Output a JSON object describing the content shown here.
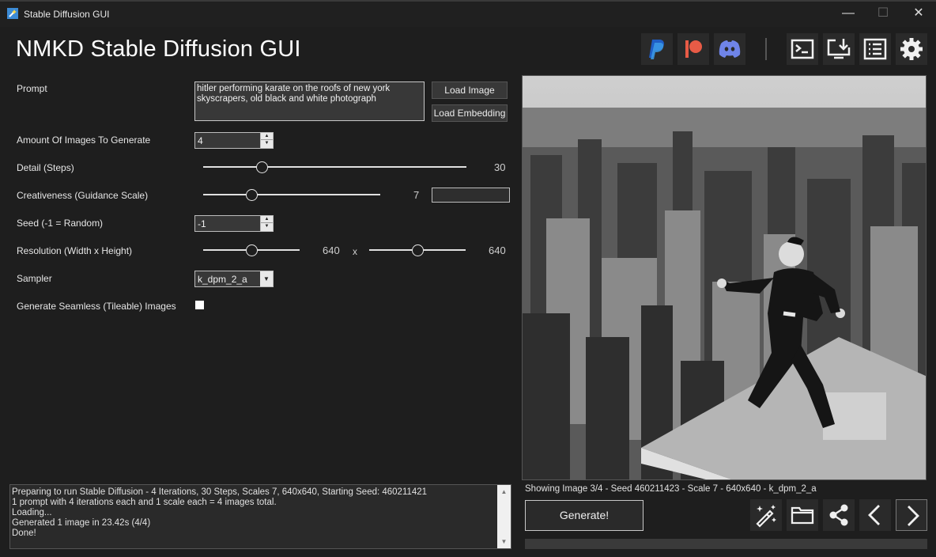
{
  "window": {
    "title": "Stable Diffusion GUI"
  },
  "header": {
    "app_title": "NMKD Stable Diffusion GUI"
  },
  "top_icons": [
    "paypal-icon",
    "patreon-icon",
    "discord-icon",
    "terminal-icon",
    "install-icon",
    "logs-icon",
    "settings-icon"
  ],
  "form": {
    "prompt_label": "Prompt",
    "prompt_value": "hitler performing karate on the roofs of new york skyscrapers, old black and white photograph",
    "load_image_label": "Load Image",
    "load_embedding_label": "Load Embedding",
    "amount_label": "Amount Of Images To Generate",
    "amount_value": "4",
    "steps_label": "Detail (Steps)",
    "steps_value": "30",
    "steps_level": 0.21,
    "guidance_label": "Creativeness (Guidance Scale)",
    "guidance_value": "7",
    "guidance_level": 0.26,
    "seed_label": "Seed (-1 = Random)",
    "seed_value": "-1",
    "resolution_label": "Resolution (Width x Height)",
    "width_value": "640",
    "height_value": "640",
    "resolution_separator": "x",
    "width_level": 0.5,
    "height_level": 0.5,
    "sampler_label": "Sampler",
    "sampler_value": "k_dpm_2_a",
    "seamless_label": "Generate Seamless (Tileable) Images"
  },
  "preview": {
    "status": "Showing Image 3/4  - Seed 460211423 - Scale 7 - 640x640 - k_dpm_2_a"
  },
  "log": {
    "lines": [
      "Preparing to run Stable Diffusion - 4 Iterations, 30 Steps, Scales 7, 640x640, Starting Seed: 460211421",
      "1 prompt with 4 iterations each and 1 scale each = 4 images total.",
      "Loading...",
      "Generated 1 image in 23.42s (4/4)",
      "Done!"
    ]
  },
  "actions": {
    "generate_label": "Generate!"
  },
  "colors": {
    "background": "#1e1e1e",
    "panel": "#2a2a2a",
    "paypal": "#1f5ec6",
    "patreon": "#e85b46",
    "discord": "#6f84e8"
  }
}
